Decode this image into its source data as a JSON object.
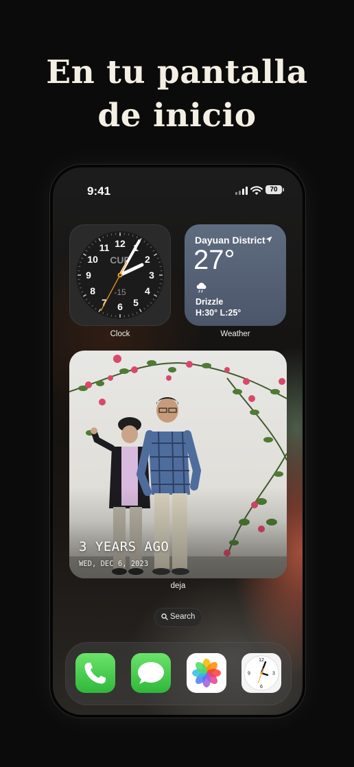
{
  "headline": {
    "line1": "En tu pantalla",
    "line2": "de inicio"
  },
  "status_bar": {
    "time": "9:41",
    "battery": "70"
  },
  "clock_widget": {
    "label": "Clock",
    "city": "CUP",
    "offset": "-15",
    "numerals": [
      "12",
      "1",
      "2",
      "3",
      "4",
      "5",
      "6",
      "7",
      "8",
      "9",
      "10",
      "11"
    ]
  },
  "weather_widget": {
    "label": "Weather",
    "location": "Dayuan District",
    "temperature": "27°",
    "condition": "Drizzle",
    "high_low": "H:30° L:25°"
  },
  "photo_widget": {
    "label": "deja",
    "memory_title": "3 YEARS AGO",
    "memory_date": "WED, DEC 6, 2023"
  },
  "search": {
    "label": "Search"
  },
  "dock": {
    "apps": [
      {
        "name": "Phone",
        "icon": "phone-icon",
        "color": "#4cd964"
      },
      {
        "name": "Messages",
        "icon": "messages-icon",
        "color": "#34c759"
      },
      {
        "name": "Photos",
        "icon": "photos-icon",
        "color": "#ffffff"
      },
      {
        "name": "Clock",
        "icon": "clock-icon",
        "color": "#ffffff"
      }
    ]
  }
}
